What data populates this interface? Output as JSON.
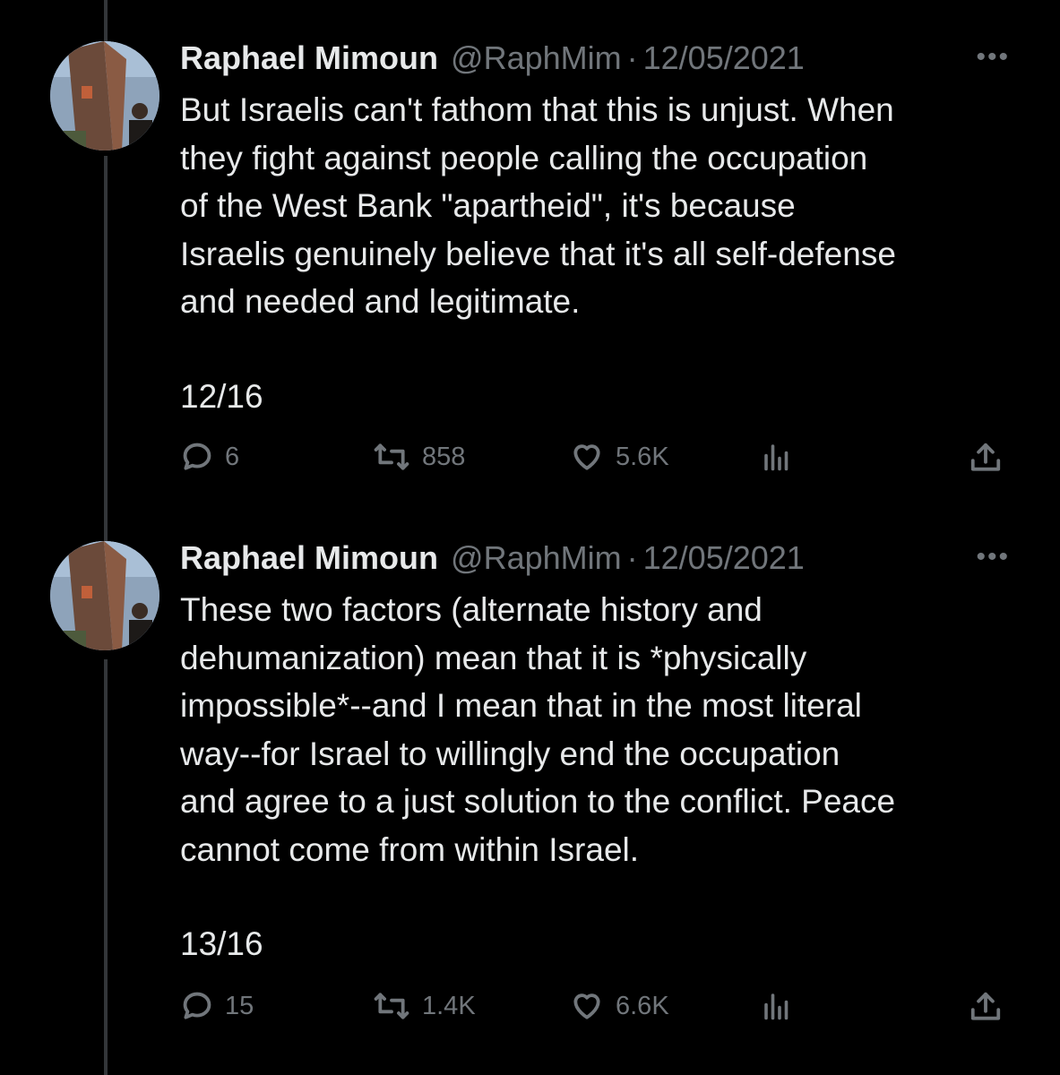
{
  "tweets": [
    {
      "name": "Raphael Mimoun",
      "handle": "@RaphMim",
      "separator": "·",
      "date": "12/05/2021",
      "more": "•••",
      "text": "But Israelis can't fathom that this is unjust. When\nthey fight against people calling the occupation\nof the West Bank \"apartheid\", it's because\nIsraelis genuinely believe that it's all self-defense\nand needed and legitimate.",
      "thread_count": "12/16",
      "replies": "6",
      "retweets": "858",
      "likes": "5.6K"
    },
    {
      "name": "Raphael Mimoun",
      "handle": "@RaphMim",
      "separator": "·",
      "date": "12/05/2021",
      "more": "•••",
      "text": "These two factors (alternate history and\ndehumanization) mean that it is *physically\nimpossible*--and I mean that in the most literal\nway--for Israel to willingly end the occupation\nand agree to a just solution to the conflict. Peace\ncannot come from within Israel.",
      "thread_count": "13/16",
      "replies": "15",
      "retweets": "1.4K",
      "likes": "6.6K"
    }
  ],
  "icons": {
    "reply": "reply-bubble-icon",
    "retweet": "retweet-arrows-icon",
    "like": "heart-icon",
    "views": "bar-chart-icon",
    "share": "share-upload-icon"
  },
  "colors": {
    "background": "#000000",
    "text": "#e7e9ea",
    "secondary": "#71767b",
    "thread_line": "#333639"
  }
}
